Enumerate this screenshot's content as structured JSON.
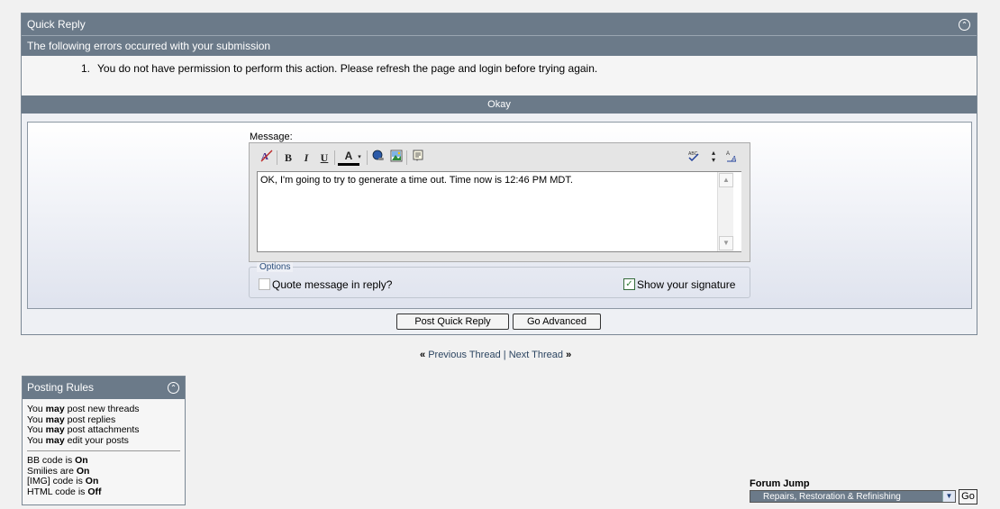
{
  "quick_reply": {
    "title": "Quick Reply",
    "error_header": "The following errors occurred with your submission",
    "errors": [
      {
        "num": "1.",
        "text": "You do not have permission to perform this action. Please refresh the page and login before trying again."
      }
    ],
    "okay_label": "Okay",
    "message_label": "Message:",
    "message_value": "OK, I'm going to try to generate a time out.  Time now is 12:46 PM MDT.",
    "options": {
      "legend": "Options",
      "quote_label": "Quote message in reply?",
      "quote_checked": false,
      "signature_label": "Show your signature",
      "signature_checked": true
    },
    "buttons": {
      "post_quick_reply": "Post Quick Reply",
      "go_advanced": "Go Advanced"
    },
    "toolbar_icons": [
      "remove-format-icon",
      "bold-icon",
      "italic-icon",
      "underline-icon",
      "font-color-icon",
      "insert-link-icon",
      "insert-image-icon",
      "quote-icon",
      "spellcheck-icon",
      "resize-icon",
      "switch-editor-mode-icon"
    ],
    "toolbar": {
      "bold": "B",
      "italic": "I",
      "underline": "U",
      "font_color": "A"
    }
  },
  "thread_nav": {
    "prev_arrow": "«",
    "previous": "Previous Thread",
    "separator": "|",
    "next": "Next Thread",
    "next_arrow": "»"
  },
  "posting_rules": {
    "title": "Posting Rules",
    "permissions": [
      {
        "pre": "You",
        "bold": "may",
        "post": "post new threads"
      },
      {
        "pre": "You",
        "bold": "may",
        "post": "post replies"
      },
      {
        "pre": "You",
        "bold": "may",
        "post": "post attachments"
      },
      {
        "pre": "You",
        "bold": "may",
        "post": "edit your posts"
      }
    ],
    "codes": [
      {
        "pre": "BB code",
        "mid": "is",
        "bold": "On"
      },
      {
        "pre": "Smilies",
        "mid": "are",
        "bold": "On"
      },
      {
        "pre": "[IMG]",
        "mid": "code is",
        "bold": "On"
      },
      {
        "pre": "HTML code",
        "mid": "is",
        "bold": "Off"
      }
    ]
  },
  "forum_jump": {
    "label": "Forum Jump",
    "selected": "Repairs, Restoration & Refinishing",
    "go_label": "Go"
  },
  "colors": {
    "header_bg": "#6b7a89",
    "page_bg": "#f1f1f1"
  }
}
